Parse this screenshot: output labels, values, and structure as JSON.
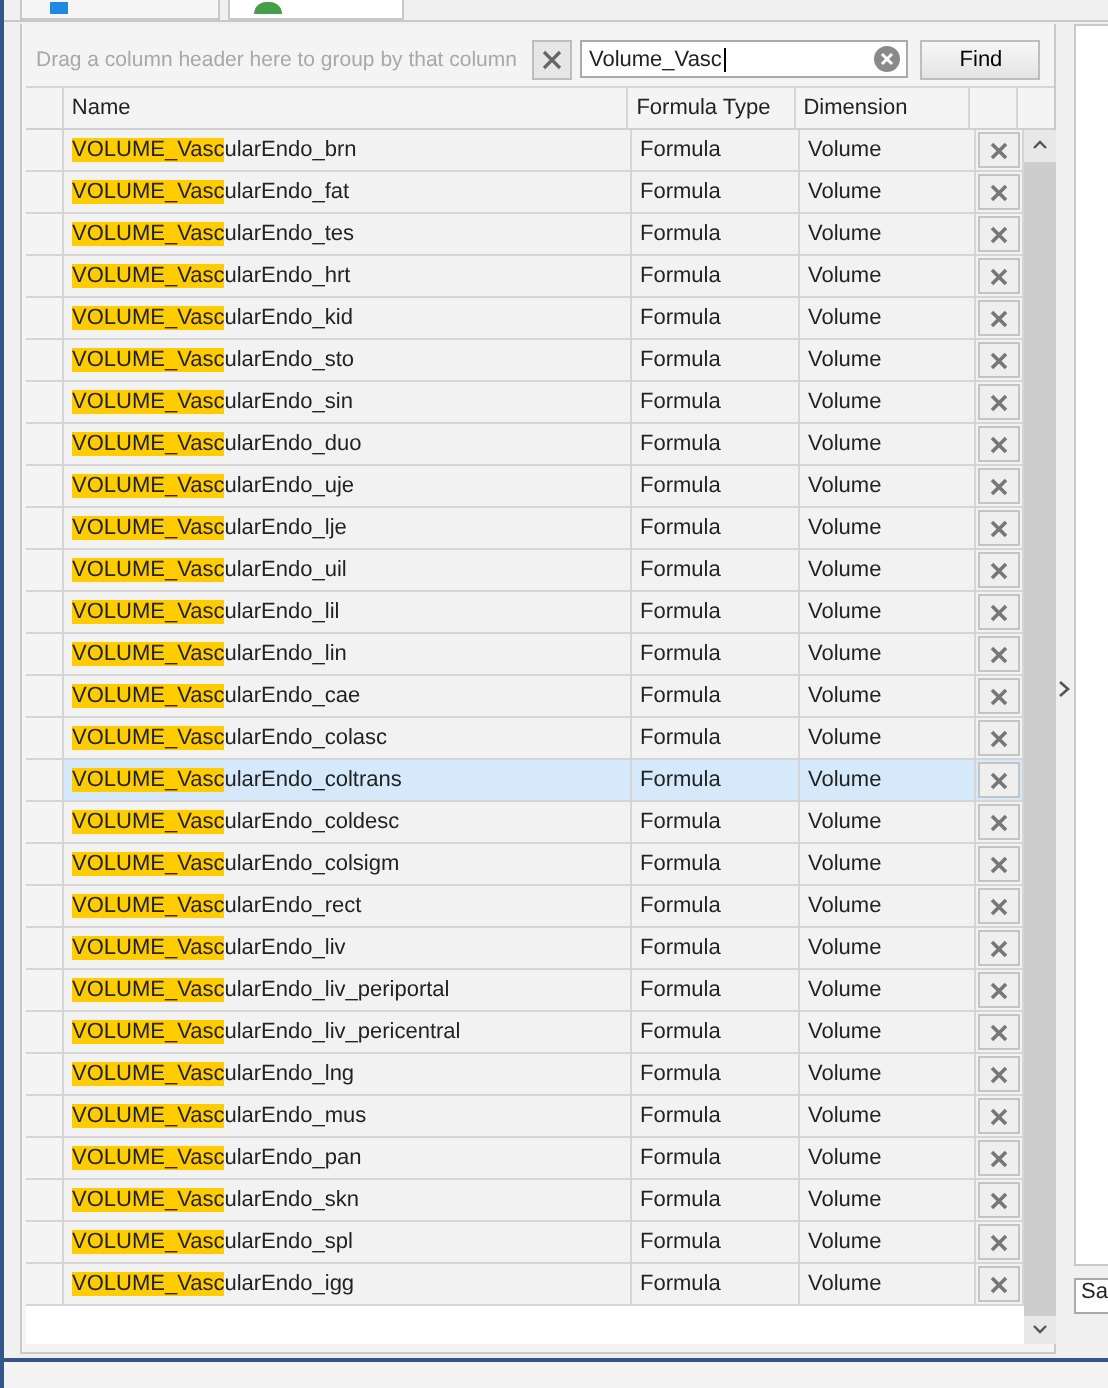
{
  "group_panel": {
    "hint": "Drag a column header here to group by that column"
  },
  "search": {
    "value": "Volume_Vasc",
    "button": "Find"
  },
  "columns": [
    "Name",
    "Formula Type",
    "Dimension"
  ],
  "rows": [
    {
      "name": "VOLUME_VascularEndo_brn",
      "type": "Formula",
      "dimension": "Volume",
      "selected": false
    },
    {
      "name": "VOLUME_VascularEndo_fat",
      "type": "Formula",
      "dimension": "Volume",
      "selected": false
    },
    {
      "name": "VOLUME_VascularEndo_tes",
      "type": "Formula",
      "dimension": "Volume",
      "selected": false
    },
    {
      "name": "VOLUME_VascularEndo_hrt",
      "type": "Formula",
      "dimension": "Volume",
      "selected": false
    },
    {
      "name": "VOLUME_VascularEndo_kid",
      "type": "Formula",
      "dimension": "Volume",
      "selected": false
    },
    {
      "name": "VOLUME_VascularEndo_sto",
      "type": "Formula",
      "dimension": "Volume",
      "selected": false
    },
    {
      "name": "VOLUME_VascularEndo_sin",
      "type": "Formula",
      "dimension": "Volume",
      "selected": false
    },
    {
      "name": "VOLUME_VascularEndo_duo",
      "type": "Formula",
      "dimension": "Volume",
      "selected": false
    },
    {
      "name": "VOLUME_VascularEndo_uje",
      "type": "Formula",
      "dimension": "Volume",
      "selected": false
    },
    {
      "name": "VOLUME_VascularEndo_lje",
      "type": "Formula",
      "dimension": "Volume",
      "selected": false
    },
    {
      "name": "VOLUME_VascularEndo_uil",
      "type": "Formula",
      "dimension": "Volume",
      "selected": false
    },
    {
      "name": "VOLUME_VascularEndo_lil",
      "type": "Formula",
      "dimension": "Volume",
      "selected": false
    },
    {
      "name": "VOLUME_VascularEndo_lin",
      "type": "Formula",
      "dimension": "Volume",
      "selected": false
    },
    {
      "name": "VOLUME_VascularEndo_cae",
      "type": "Formula",
      "dimension": "Volume",
      "selected": false
    },
    {
      "name": "VOLUME_VascularEndo_colasc",
      "type": "Formula",
      "dimension": "Volume",
      "selected": false
    },
    {
      "name": "VOLUME_VascularEndo_coltrans",
      "type": "Formula",
      "dimension": "Volume",
      "selected": true
    },
    {
      "name": "VOLUME_VascularEndo_coldesc",
      "type": "Formula",
      "dimension": "Volume",
      "selected": false
    },
    {
      "name": "VOLUME_VascularEndo_colsigm",
      "type": "Formula",
      "dimension": "Volume",
      "selected": false
    },
    {
      "name": "VOLUME_VascularEndo_rect",
      "type": "Formula",
      "dimension": "Volume",
      "selected": false
    },
    {
      "name": "VOLUME_VascularEndo_liv",
      "type": "Formula",
      "dimension": "Volume",
      "selected": false
    },
    {
      "name": "VOLUME_VascularEndo_liv_periportal",
      "type": "Formula",
      "dimension": "Volume",
      "selected": false
    },
    {
      "name": "VOLUME_VascularEndo_liv_pericentral",
      "type": "Formula",
      "dimension": "Volume",
      "selected": false
    },
    {
      "name": "VOLUME_VascularEndo_lng",
      "type": "Formula",
      "dimension": "Volume",
      "selected": false
    },
    {
      "name": "VOLUME_VascularEndo_mus",
      "type": "Formula",
      "dimension": "Volume",
      "selected": false
    },
    {
      "name": "VOLUME_VascularEndo_pan",
      "type": "Formula",
      "dimension": "Volume",
      "selected": false
    },
    {
      "name": "VOLUME_VascularEndo_skn",
      "type": "Formula",
      "dimension": "Volume",
      "selected": false
    },
    {
      "name": "VOLUME_VascularEndo_spl",
      "type": "Formula",
      "dimension": "Volume",
      "selected": false
    },
    {
      "name": "VOLUME_VascularEndo_igg",
      "type": "Formula",
      "dimension": "Volume",
      "selected": false
    }
  ],
  "side_field": {
    "value": "Sa"
  }
}
